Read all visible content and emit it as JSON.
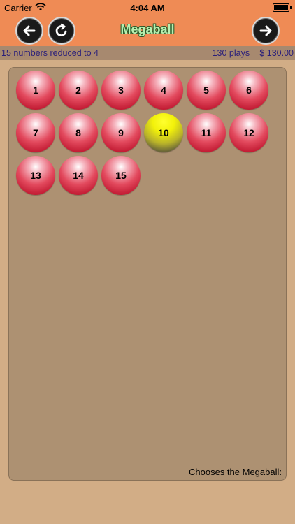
{
  "status": {
    "carrier": "Carrier",
    "time": "4:04 AM"
  },
  "nav": {
    "title": "Megaball"
  },
  "info": {
    "left": "15 numbers reduced to 4",
    "right": "130 plays = $ 130.00"
  },
  "balls": [
    "1",
    "2",
    "3",
    "4",
    "5",
    "6",
    "7",
    "8",
    "9",
    "10",
    "11",
    "12",
    "13",
    "14",
    "15"
  ],
  "selected_ball": "10",
  "footer": "Chooses the Megaball:"
}
